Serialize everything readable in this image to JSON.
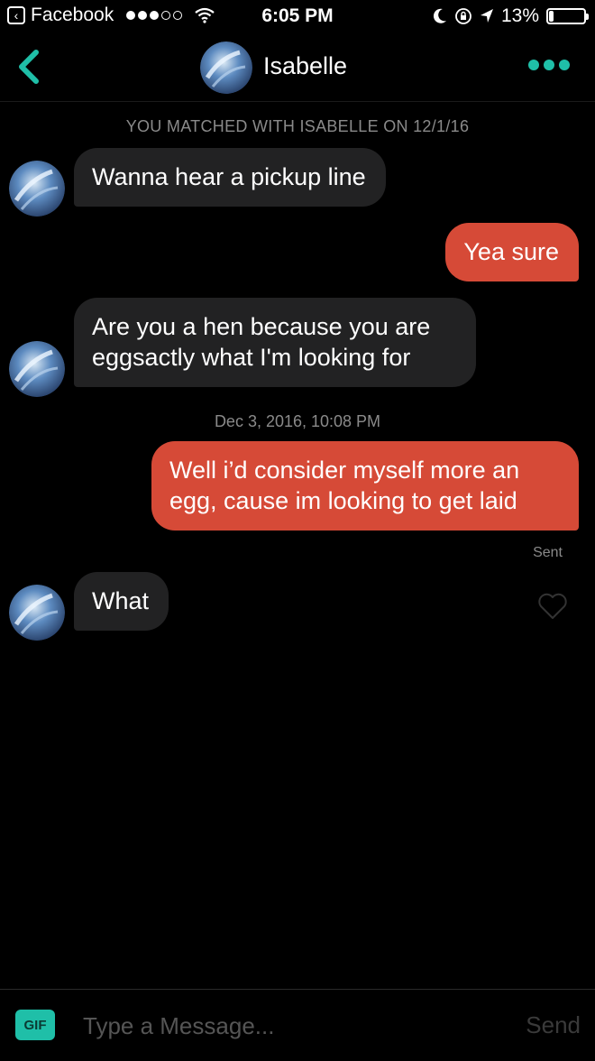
{
  "status_bar": {
    "back_app": "Facebook",
    "time": "6:05 PM",
    "battery": "13%",
    "battery_level": 0.13,
    "signal_bars": 3
  },
  "header": {
    "contact_name": "Isabelle",
    "accent_color": "#1fbfa8"
  },
  "match_notice": "YOU MATCHED WITH ISABELLE ON 12/1/16",
  "messages": [
    {
      "sender": "them",
      "text": "Wanna hear a pickup line"
    },
    {
      "sender": "me",
      "text": "Yea sure"
    },
    {
      "sender": "them",
      "text": "Are you a hen because you are eggsactly what I'm looking for"
    },
    {
      "sender": "me",
      "text": "Well i’d consider myself more an egg, cause im looking to get laid"
    },
    {
      "sender": "them",
      "text": "What"
    }
  ],
  "timestamp": "Dec 3, 2016, 10:08 PM",
  "sent_label": "Sent",
  "composer": {
    "gif_label": "GIF",
    "placeholder": "Type a Message...",
    "send_label": "Send"
  },
  "colors": {
    "incoming_bubble": "#222223",
    "outgoing_bubble": "#d64a37",
    "background": "#000000"
  }
}
